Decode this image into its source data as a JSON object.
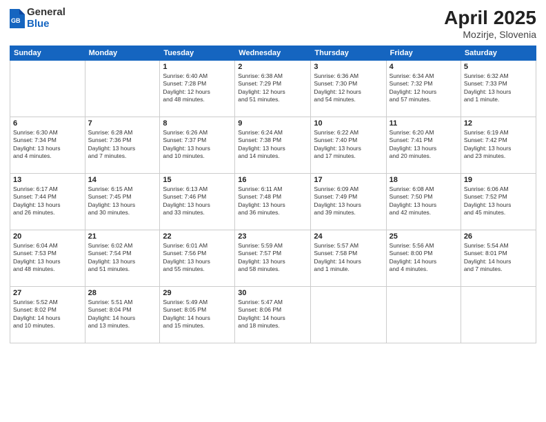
{
  "header": {
    "logo_general": "General",
    "logo_blue": "Blue",
    "title": "April 2025",
    "location": "Mozirje, Slovenia"
  },
  "days": [
    "Sunday",
    "Monday",
    "Tuesday",
    "Wednesday",
    "Thursday",
    "Friday",
    "Saturday"
  ],
  "weeks": [
    [
      {
        "date": "",
        "info": ""
      },
      {
        "date": "",
        "info": ""
      },
      {
        "date": "1",
        "info": "Sunrise: 6:40 AM\nSunset: 7:28 PM\nDaylight: 12 hours\nand 48 minutes."
      },
      {
        "date": "2",
        "info": "Sunrise: 6:38 AM\nSunset: 7:29 PM\nDaylight: 12 hours\nand 51 minutes."
      },
      {
        "date": "3",
        "info": "Sunrise: 6:36 AM\nSunset: 7:30 PM\nDaylight: 12 hours\nand 54 minutes."
      },
      {
        "date": "4",
        "info": "Sunrise: 6:34 AM\nSunset: 7:32 PM\nDaylight: 12 hours\nand 57 minutes."
      },
      {
        "date": "5",
        "info": "Sunrise: 6:32 AM\nSunset: 7:33 PM\nDaylight: 13 hours\nand 1 minute."
      }
    ],
    [
      {
        "date": "6",
        "info": "Sunrise: 6:30 AM\nSunset: 7:34 PM\nDaylight: 13 hours\nand 4 minutes."
      },
      {
        "date": "7",
        "info": "Sunrise: 6:28 AM\nSunset: 7:36 PM\nDaylight: 13 hours\nand 7 minutes."
      },
      {
        "date": "8",
        "info": "Sunrise: 6:26 AM\nSunset: 7:37 PM\nDaylight: 13 hours\nand 10 minutes."
      },
      {
        "date": "9",
        "info": "Sunrise: 6:24 AM\nSunset: 7:38 PM\nDaylight: 13 hours\nand 14 minutes."
      },
      {
        "date": "10",
        "info": "Sunrise: 6:22 AM\nSunset: 7:40 PM\nDaylight: 13 hours\nand 17 minutes."
      },
      {
        "date": "11",
        "info": "Sunrise: 6:20 AM\nSunset: 7:41 PM\nDaylight: 13 hours\nand 20 minutes."
      },
      {
        "date": "12",
        "info": "Sunrise: 6:19 AM\nSunset: 7:42 PM\nDaylight: 13 hours\nand 23 minutes."
      }
    ],
    [
      {
        "date": "13",
        "info": "Sunrise: 6:17 AM\nSunset: 7:44 PM\nDaylight: 13 hours\nand 26 minutes."
      },
      {
        "date": "14",
        "info": "Sunrise: 6:15 AM\nSunset: 7:45 PM\nDaylight: 13 hours\nand 30 minutes."
      },
      {
        "date": "15",
        "info": "Sunrise: 6:13 AM\nSunset: 7:46 PM\nDaylight: 13 hours\nand 33 minutes."
      },
      {
        "date": "16",
        "info": "Sunrise: 6:11 AM\nSunset: 7:48 PM\nDaylight: 13 hours\nand 36 minutes."
      },
      {
        "date": "17",
        "info": "Sunrise: 6:09 AM\nSunset: 7:49 PM\nDaylight: 13 hours\nand 39 minutes."
      },
      {
        "date": "18",
        "info": "Sunrise: 6:08 AM\nSunset: 7:50 PM\nDaylight: 13 hours\nand 42 minutes."
      },
      {
        "date": "19",
        "info": "Sunrise: 6:06 AM\nSunset: 7:52 PM\nDaylight: 13 hours\nand 45 minutes."
      }
    ],
    [
      {
        "date": "20",
        "info": "Sunrise: 6:04 AM\nSunset: 7:53 PM\nDaylight: 13 hours\nand 48 minutes."
      },
      {
        "date": "21",
        "info": "Sunrise: 6:02 AM\nSunset: 7:54 PM\nDaylight: 13 hours\nand 51 minutes."
      },
      {
        "date": "22",
        "info": "Sunrise: 6:01 AM\nSunset: 7:56 PM\nDaylight: 13 hours\nand 55 minutes."
      },
      {
        "date": "23",
        "info": "Sunrise: 5:59 AM\nSunset: 7:57 PM\nDaylight: 13 hours\nand 58 minutes."
      },
      {
        "date": "24",
        "info": "Sunrise: 5:57 AM\nSunset: 7:58 PM\nDaylight: 14 hours\nand 1 minute."
      },
      {
        "date": "25",
        "info": "Sunrise: 5:56 AM\nSunset: 8:00 PM\nDaylight: 14 hours\nand 4 minutes."
      },
      {
        "date": "26",
        "info": "Sunrise: 5:54 AM\nSunset: 8:01 PM\nDaylight: 14 hours\nand 7 minutes."
      }
    ],
    [
      {
        "date": "27",
        "info": "Sunrise: 5:52 AM\nSunset: 8:02 PM\nDaylight: 14 hours\nand 10 minutes."
      },
      {
        "date": "28",
        "info": "Sunrise: 5:51 AM\nSunset: 8:04 PM\nDaylight: 14 hours\nand 13 minutes."
      },
      {
        "date": "29",
        "info": "Sunrise: 5:49 AM\nSunset: 8:05 PM\nDaylight: 14 hours\nand 15 minutes."
      },
      {
        "date": "30",
        "info": "Sunrise: 5:47 AM\nSunset: 8:06 PM\nDaylight: 14 hours\nand 18 minutes."
      },
      {
        "date": "",
        "info": ""
      },
      {
        "date": "",
        "info": ""
      },
      {
        "date": "",
        "info": ""
      }
    ]
  ]
}
